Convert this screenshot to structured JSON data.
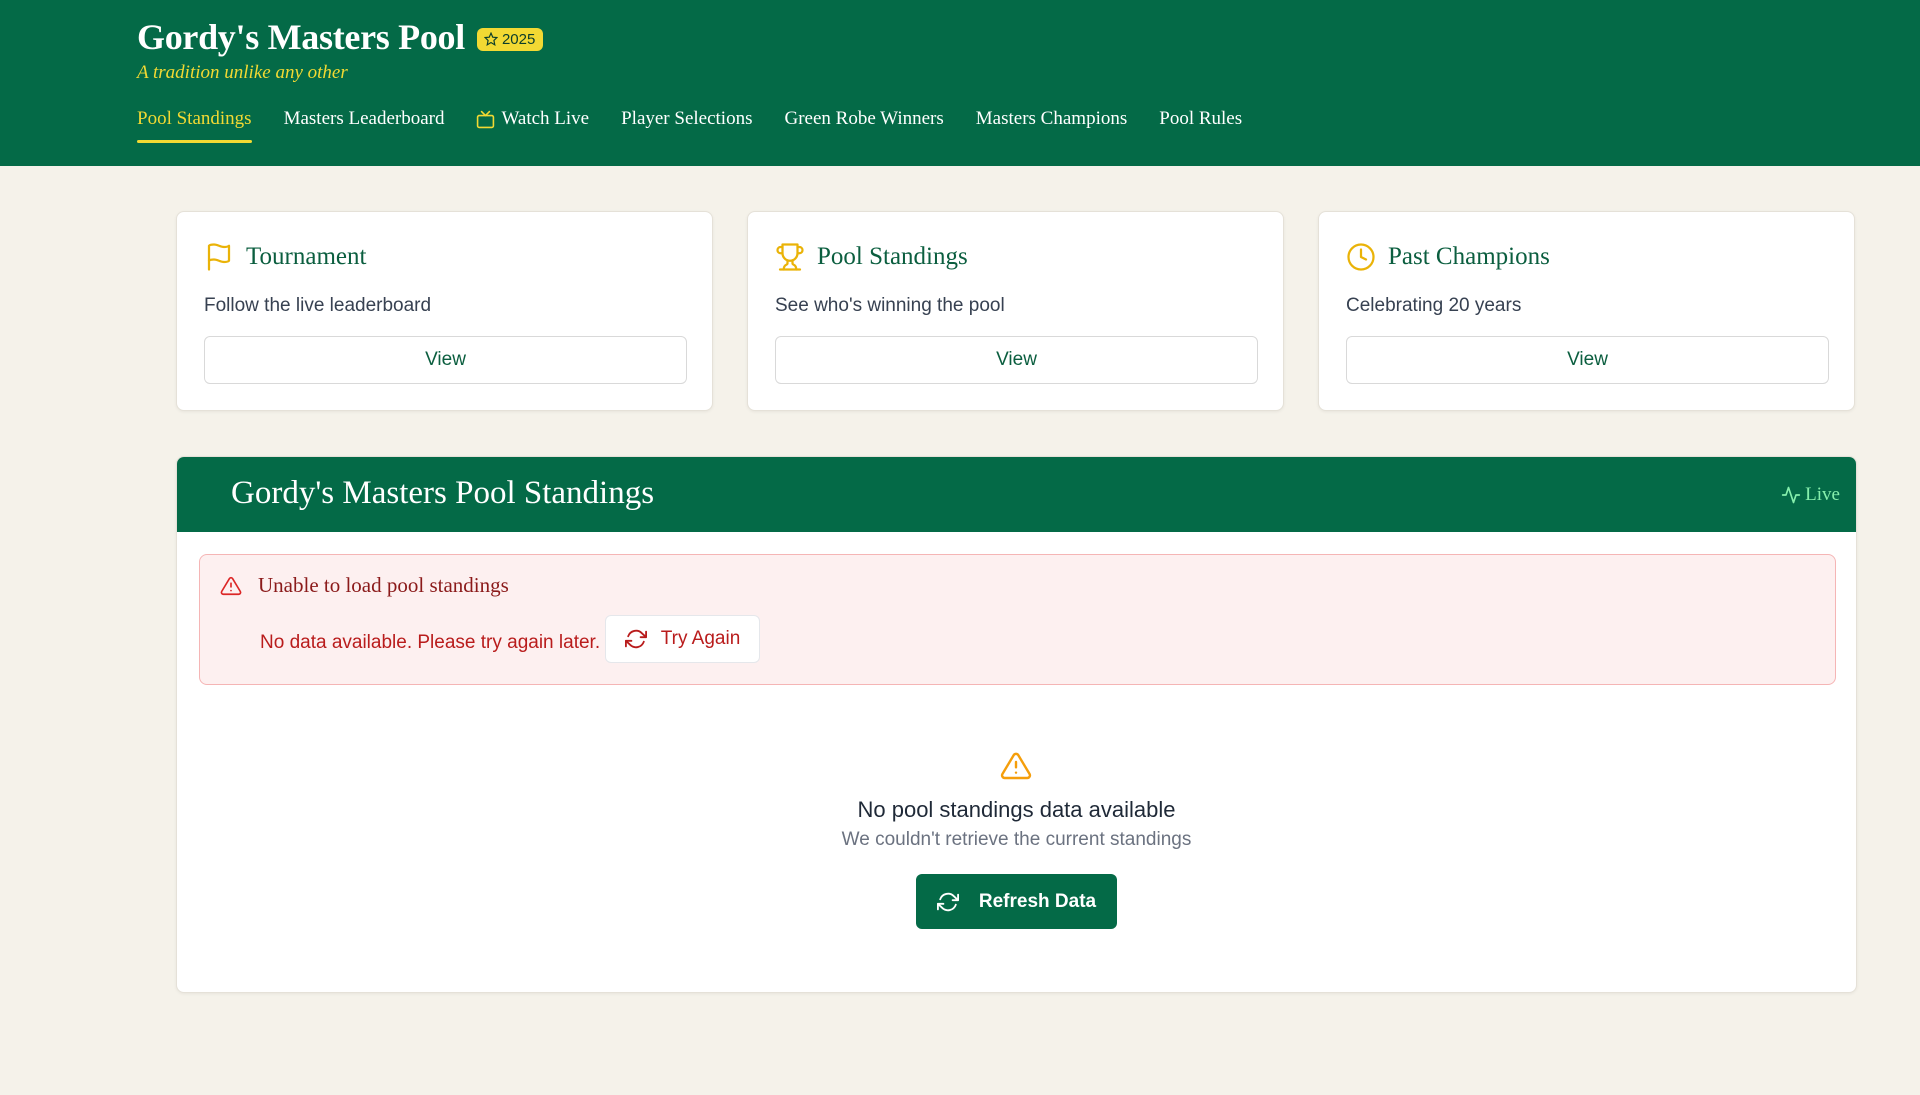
{
  "header": {
    "title": "Gordy's Masters Pool",
    "year_badge": "2025",
    "tagline": "A tradition unlike any other"
  },
  "nav": {
    "items": [
      {
        "label": "Pool Standings",
        "active": true
      },
      {
        "label": "Masters Leaderboard"
      },
      {
        "label": "Watch Live",
        "icon": "tv-icon"
      },
      {
        "label": "Player Selections"
      },
      {
        "label": "Green Robe Winners"
      },
      {
        "label": "Masters Champions"
      },
      {
        "label": "Pool Rules"
      }
    ]
  },
  "cards": [
    {
      "icon": "flag-icon",
      "title": "Tournament",
      "description": "Follow the live leaderboard",
      "button": "View"
    },
    {
      "icon": "trophy-icon",
      "title": "Pool Standings",
      "description": "See who's winning the pool",
      "button": "View"
    },
    {
      "icon": "clock-icon",
      "title": "Past Champions",
      "description": "Celebrating 20 years",
      "button": "View"
    }
  ],
  "standings": {
    "title": "Gordy's Masters Pool Standings",
    "live_label": "Live",
    "error": {
      "title": "Unable to load pool standings",
      "message": "No data available. Please try again later.",
      "retry_label": "Try Again"
    },
    "empty": {
      "title": "No pool standings data available",
      "subtitle": "We couldn't retrieve the current standings",
      "refresh_label": "Refresh Data"
    }
  },
  "colors": {
    "brand_green": "#046a47",
    "accent_yellow": "#f2d933",
    "error_red": "#b91c1c",
    "warning_amber": "#f59e0b",
    "background": "#f5f2ea"
  }
}
